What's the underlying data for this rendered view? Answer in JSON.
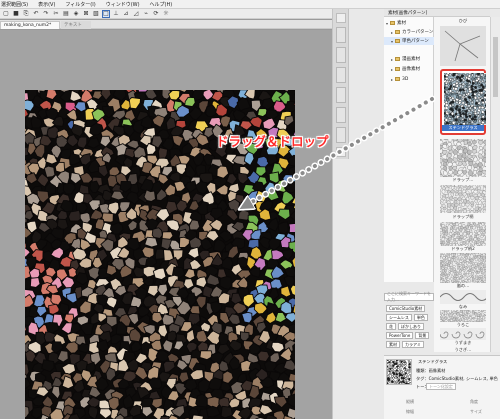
{
  "menubar": {
    "items": [
      "選択範囲(S)",
      "表示(V)",
      "フィルター(I)",
      "ウィンドウ(W)",
      "ヘルプ(H)"
    ]
  },
  "tabs": {
    "active": "making_kona_num2*",
    "inactive": "テキスト"
  },
  "material": {
    "header": "素材[画像パターン]",
    "tree": [
      {
        "label": "素材",
        "level": 0,
        "expanded": true,
        "folder": false
      },
      {
        "label": "カラーパターン",
        "level": 1,
        "expanded": false,
        "folder": true
      },
      {
        "label": "単色パターン",
        "level": 1,
        "expanded": true,
        "folder": true,
        "selected": true
      },
      {
        "label": "漫画素材",
        "level": 1,
        "expanded": false,
        "folder": true
      },
      {
        "label": "画像素材",
        "level": 1,
        "expanded": false,
        "folder": true
      },
      {
        "label": "3D",
        "level": 1,
        "expanded": false,
        "folder": true
      }
    ],
    "thumb_labels": [
      "ひび",
      "ステンドグラス",
      "ドラップ…",
      "ドラップ柄",
      "ドラップ柄2",
      "嵐の…",
      "なみ",
      "うろこ",
      "うずまき",
      "うさぎ…"
    ],
    "search_placeholder": "ここに検索キーワードを入力…",
    "tags": [
      [
        "ComicStudio素材"
      ],
      [
        "シームレス",
        "単色"
      ],
      [
        "花",
        "ぼかしあり"
      ],
      [
        "PowerTone",
        "背景"
      ],
      [
        "素材",
        "カラアミ"
      ]
    ]
  },
  "properties": {
    "name": "ステンドグラス",
    "type_line": "種類：画像素材",
    "tag_line": "タグ：ComicStudio素材, シームレス, 単色",
    "tone_label": "トーンを",
    "field_button": "トーン化設定",
    "left_labels": [
      "縦横",
      "線幅"
    ],
    "right_labels": [
      "角度",
      "サイズ"
    ]
  },
  "annotation": {
    "text": "ドラッグ＆ドロップ",
    "color": "#ff2a2a",
    "highlight_color": "#e23c35"
  }
}
